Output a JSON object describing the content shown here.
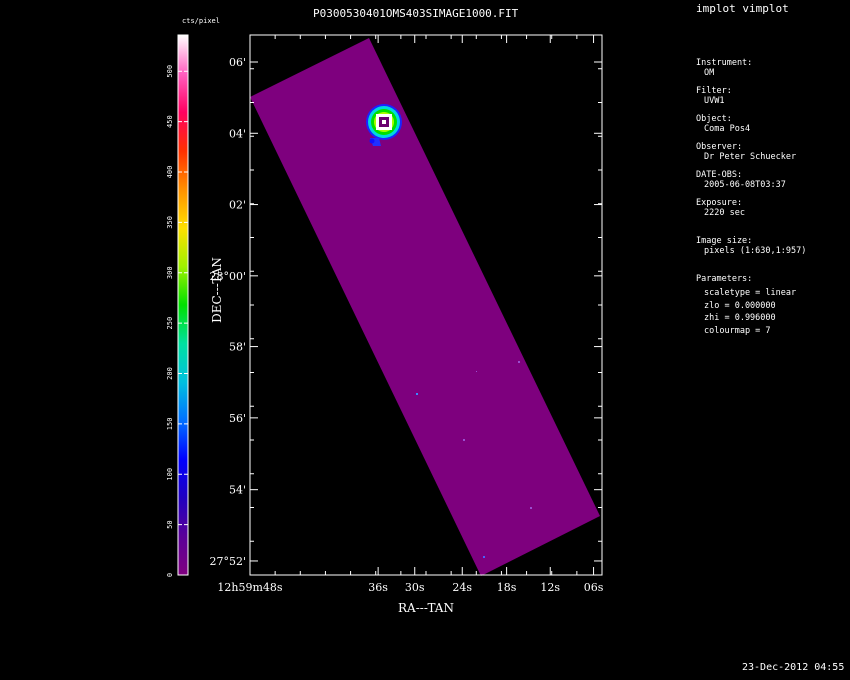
{
  "title": "P0300530401OMS403SIMAGE1000.FIT",
  "app_label": "implot vimplot",
  "timestamp": "23-Dec-2012 04:55",
  "colorbar": {
    "unit_label": "cts/pixel",
    "ticks": [
      "0",
      "50",
      "100",
      "150",
      "200",
      "250",
      "300",
      "350",
      "400",
      "450",
      "500"
    ],
    "max": 536,
    "colormap_stops": [
      "#800080",
      "#5a0098",
      "#2000c0",
      "#0000ff",
      "#0070ff",
      "#00c0e0",
      "#00e0a0",
      "#00e000",
      "#a0f000",
      "#ffe000",
      "#ff9000",
      "#ff3000",
      "#ff0060",
      "#ff60c0",
      "#ffffff"
    ]
  },
  "axes": {
    "xlabel": "RA---TAN",
    "ylabel": "DEC---TAN",
    "x_ticks": [
      {
        "label": "12h59m48s",
        "pos": 0.0
      },
      {
        "label": "36s",
        "pos": 0.364
      },
      {
        "label": "30s",
        "pos": 0.468
      },
      {
        "label": "24s",
        "pos": 0.603
      },
      {
        "label": "18s",
        "pos": 0.729
      },
      {
        "label": "12s",
        "pos": 0.853
      },
      {
        "label": "06s",
        "pos": 0.976
      }
    ],
    "y_ticks": [
      {
        "label": "06'",
        "pos": 0.95
      },
      {
        "label": "04'",
        "pos": 0.818
      },
      {
        "label": "02'",
        "pos": 0.686
      },
      {
        "label": "28°00'",
        "pos": 0.554
      },
      {
        "label": "58'",
        "pos": 0.423
      },
      {
        "label": "56'",
        "pos": 0.291
      },
      {
        "label": "54'",
        "pos": 0.158
      },
      {
        "label": "27°52'",
        "pos": 0.026
      }
    ]
  },
  "info": {
    "instrument_label": "Instrument:",
    "instrument": "OM",
    "filter_label": "Filter:",
    "filter": "UVW1",
    "object_label": "Object:",
    "object": "Coma Pos4",
    "observer_label": "Observer:",
    "observer": "Dr Peter Schuecker",
    "date_label": "DATE-OBS:",
    "date": "2005-06-08T03:37",
    "exposure_label": "Exposure:",
    "exposure": "2220 sec",
    "imagesize_label": "Image size:",
    "imagesize": "pixels (1:630,1:957)",
    "parameters_label": "Parameters:",
    "scaletype": "scaletype = linear",
    "zlo": "zlo = 0.000000",
    "zhi": "zhi = 0.996000",
    "colourmap": "colourmap =   7"
  },
  "colors": {
    "background": "#000000",
    "image_fill": "#7e007e",
    "frame": "#ffffff"
  }
}
